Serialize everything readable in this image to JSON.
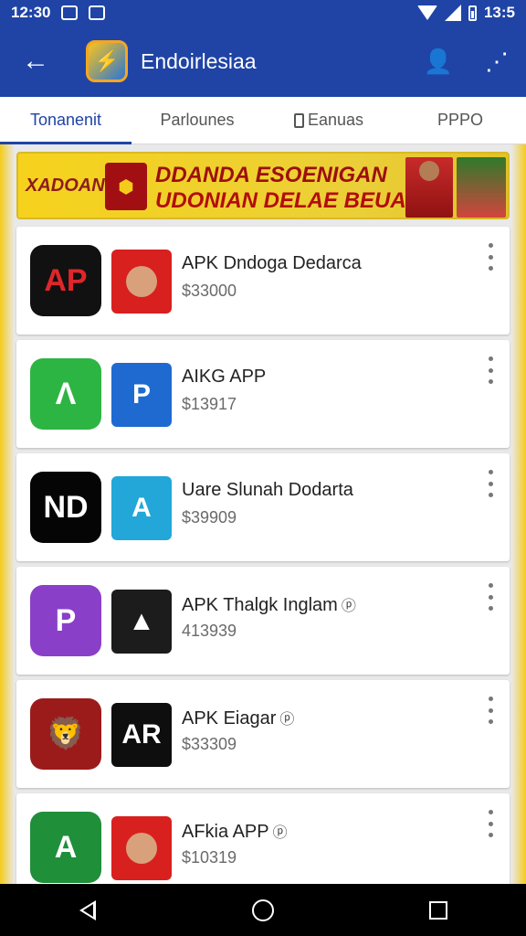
{
  "status_bar": {
    "time_left": "12:30",
    "time_right": "13:5"
  },
  "app_bar": {
    "title": "Endoirlesiaa",
    "back_glyph": "←",
    "share_glyph": "⋰",
    "profile_glyph": "👤"
  },
  "tabs": [
    {
      "label": "Tonanenit",
      "active": true
    },
    {
      "label": "Parlounes",
      "active": false
    },
    {
      "label": "Eanuas",
      "active": false,
      "icon": "phone-icon"
    },
    {
      "label": "PPPO",
      "active": false
    }
  ],
  "banner": {
    "left_text": "XADOAN",
    "line1": "DDANDA ESOENIGAN",
    "line2": "UDONIAN DELAE BEUADIS"
  },
  "apps": [
    {
      "name": "APK Dndoga Dedarca",
      "price": "$33000",
      "icon1_text": "AP",
      "icon1_color": "#111111",
      "icon1_accent": "#e0262a",
      "icon2_type": "face",
      "icon2_color": "#d8201f",
      "badge": ""
    },
    {
      "name": "AIKG APP",
      "price": "$13917",
      "icon1_text": "Λ",
      "icon1_color": "#2db543",
      "icon1_accent": "#ffffff",
      "icon2_type": "text",
      "icon2_text": "P",
      "icon2_color": "#1e6ad1",
      "badge": ""
    },
    {
      "name": "Uare Slunah Dodarta",
      "price": "$39909",
      "icon1_text": "ND",
      "icon1_color": "#050505",
      "icon1_accent": "#ffffff",
      "icon2_type": "text",
      "icon2_text": "A",
      "icon2_color": "#22a7d8",
      "badge": ""
    },
    {
      "name": "APK Thalgk Inglam",
      "price": "413939",
      "icon1_text": "P",
      "icon1_color": "#8a3fc8",
      "icon1_accent": "#ffffff",
      "icon2_type": "text",
      "icon2_text": "▲",
      "icon2_color": "#1c1c1c",
      "badge": "ⓟ"
    },
    {
      "name": "APK Eiagar",
      "price": "$33309",
      "icon1_text": "🦁",
      "icon1_color": "#9b1b1b",
      "icon1_accent": "#f4c020",
      "icon2_type": "text",
      "icon2_text": "AR",
      "icon2_color": "#0e0e0e",
      "badge": "ⓟ"
    },
    {
      "name": "AFkia APP",
      "price": "$10319",
      "icon1_text": "A",
      "icon1_color": "#1f8f3a",
      "icon1_accent": "#ffffff",
      "icon2_type": "face",
      "icon2_color": "#d8201f",
      "badge": "ⓟ"
    }
  ]
}
